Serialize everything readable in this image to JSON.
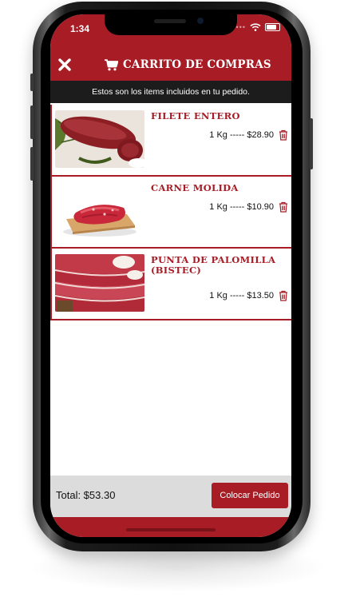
{
  "status_bar": {
    "time": "1:34"
  },
  "header": {
    "title": "CARRITO DE COMPRAS",
    "close_icon": "close-icon",
    "cart_icon": "shopping-cart-icon"
  },
  "subheader": {
    "text": "Estos son los items incluidos en tu pedido."
  },
  "cart": {
    "items": [
      {
        "name": "FILETE ENTERO",
        "price_line": "1 Kg ----- $28.90",
        "image": "beef-tenderloin-photo"
      },
      {
        "name": "CARNE MOLIDA",
        "price_line": "1 Kg ----- $10.90",
        "image": "ground-beef-photo"
      },
      {
        "name": "PUNTA DE PALOMILLA (BISTEC)",
        "price_line": "1 Kg ----- $13.50",
        "image": "sliced-steak-photo"
      }
    ]
  },
  "footer": {
    "total_label": "Total: $53.30",
    "place_order_label": "Colocar Pedido"
  },
  "colors": {
    "brand_red": "#a71c25",
    "subheader_bg": "#1c1c1c",
    "footer_bg": "#dcdcdc"
  }
}
